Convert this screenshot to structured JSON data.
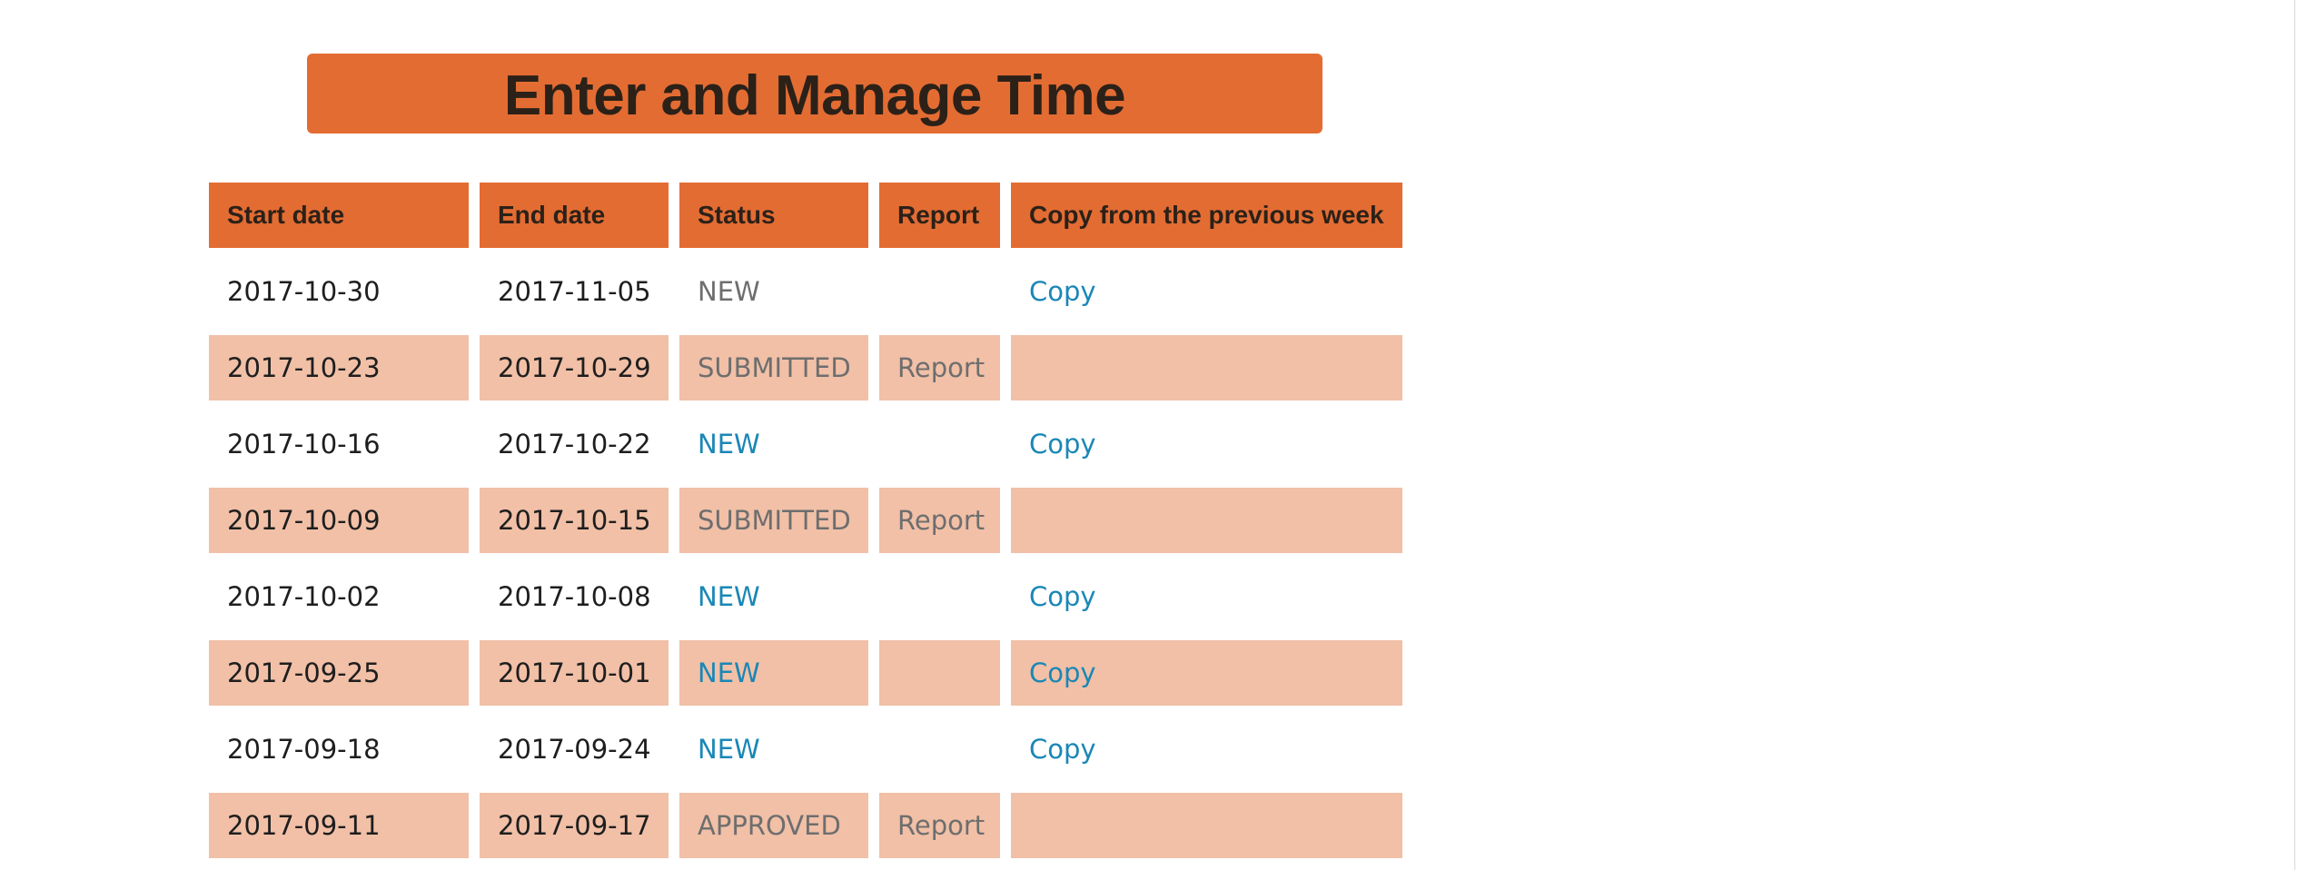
{
  "page": {
    "title": "Enter and Manage Time"
  },
  "colors": {
    "accent": "#e36c33",
    "row_alt": "#f1c0a7",
    "link": "#1a87b6",
    "muted_text": "#6e6e6e"
  },
  "table": {
    "columns": [
      "Start date",
      "End date",
      "Status",
      "Report",
      "Copy from the previous week"
    ],
    "rows": [
      {
        "start": "2017-10-30",
        "end": "2017-11-05",
        "status": "NEW",
        "status_link": false,
        "report": "",
        "copy": "Copy"
      },
      {
        "start": "2017-10-23",
        "end": "2017-10-29",
        "status": "SUBMITTED",
        "status_link": false,
        "report": "Report",
        "copy": ""
      },
      {
        "start": "2017-10-16",
        "end": "2017-10-22",
        "status": "NEW",
        "status_link": true,
        "report": "",
        "copy": "Copy"
      },
      {
        "start": "2017-10-09",
        "end": "2017-10-15",
        "status": "SUBMITTED",
        "status_link": false,
        "report": "Report",
        "copy": ""
      },
      {
        "start": "2017-10-02",
        "end": "2017-10-08",
        "status": "NEW",
        "status_link": true,
        "report": "",
        "copy": "Copy"
      },
      {
        "start": "2017-09-25",
        "end": "2017-10-01",
        "status": "NEW",
        "status_link": true,
        "report": "",
        "copy": "Copy"
      },
      {
        "start": "2017-09-18",
        "end": "2017-09-24",
        "status": "NEW",
        "status_link": true,
        "report": "",
        "copy": "Copy"
      },
      {
        "start": "2017-09-11",
        "end": "2017-09-17",
        "status": "APPROVED",
        "status_link": false,
        "report": "Report",
        "copy": ""
      }
    ]
  }
}
